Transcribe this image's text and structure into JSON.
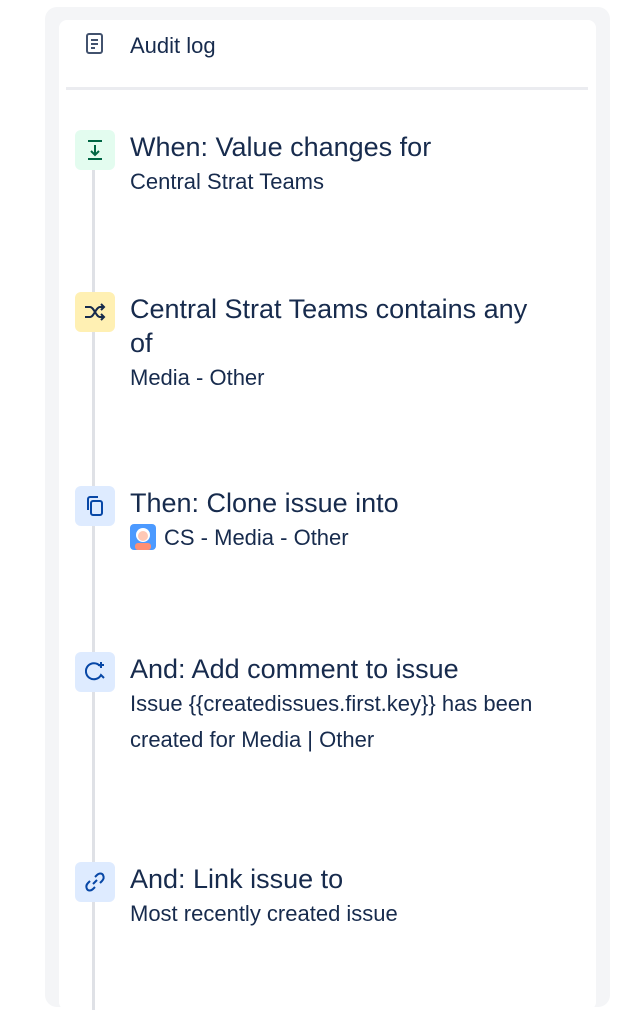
{
  "audit": {
    "label": "Audit log",
    "icon": "document-icon"
  },
  "steps": [
    {
      "icon": "trigger-icon",
      "color": "#e3fcef",
      "title": "When: Value changes for",
      "subtitle": "Central Strat Teams"
    },
    {
      "icon": "condition-branch-icon",
      "color": "#fff0b3",
      "title": "Central Strat Teams contains any of",
      "subtitle": "Media - Other"
    },
    {
      "icon": "clone-icon",
      "color": "#deebff",
      "title": "Then: Clone issue into",
      "subtitle": "CS - Media - Other"
    },
    {
      "icon": "comment-icon",
      "color": "#deebff",
      "title": "And: Add comment to issue",
      "subtitle": "Issue {{createdissues.first.key}} has been created for Media | Other"
    },
    {
      "icon": "link-icon",
      "color": "#deebff",
      "title": "And: Link issue to",
      "subtitle": "Most recently created issue"
    }
  ]
}
